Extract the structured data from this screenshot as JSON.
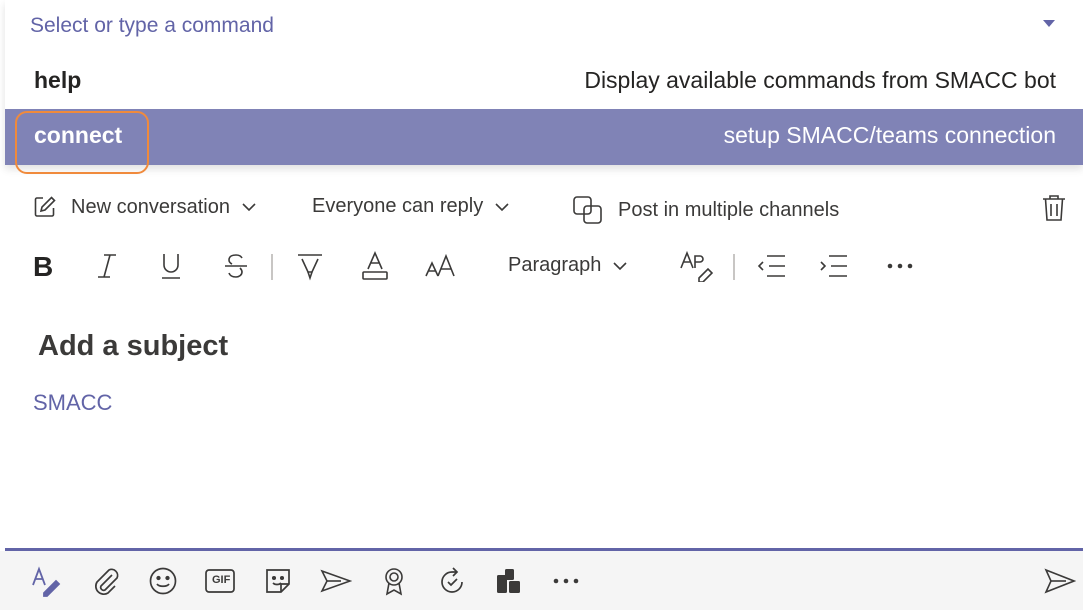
{
  "command_menu": {
    "placeholder": "Select or type a command",
    "items": [
      {
        "name": "help",
        "description": "Display available commands from SMACC bot",
        "selected": false
      },
      {
        "name": "connect",
        "description": "setup SMACC/teams connection",
        "selected": true
      }
    ],
    "selected_color": "#8083b6",
    "highlight_color": "#f08a3c"
  },
  "options": {
    "new_conversation": "New conversation",
    "reply_setting": "Everyone can reply",
    "post_multiple": "Post in multiple channels"
  },
  "format_toolbar": {
    "paragraph": "Paragraph",
    "icons": [
      "bold-icon",
      "italic-icon",
      "underline-icon",
      "strikethrough-icon",
      "highlight-icon",
      "font-color-icon",
      "font-size-icon",
      "clear-formatting-icon",
      "decrease-indent-icon",
      "increase-indent-icon",
      "more-options-icon"
    ]
  },
  "compose": {
    "subject_placeholder": "Add a subject",
    "body": "SMACC"
  },
  "bottom_toolbar": {
    "gif_label": "GIF",
    "icons": [
      "format-icon",
      "attach-icon",
      "emoji-icon",
      "gif-icon",
      "sticker-icon",
      "meet-now-icon",
      "praise-icon",
      "loop-icon",
      "apps-icon",
      "more-icon",
      "send-icon"
    ]
  },
  "colors": {
    "accent": "#6264a7",
    "text": "#252423"
  }
}
